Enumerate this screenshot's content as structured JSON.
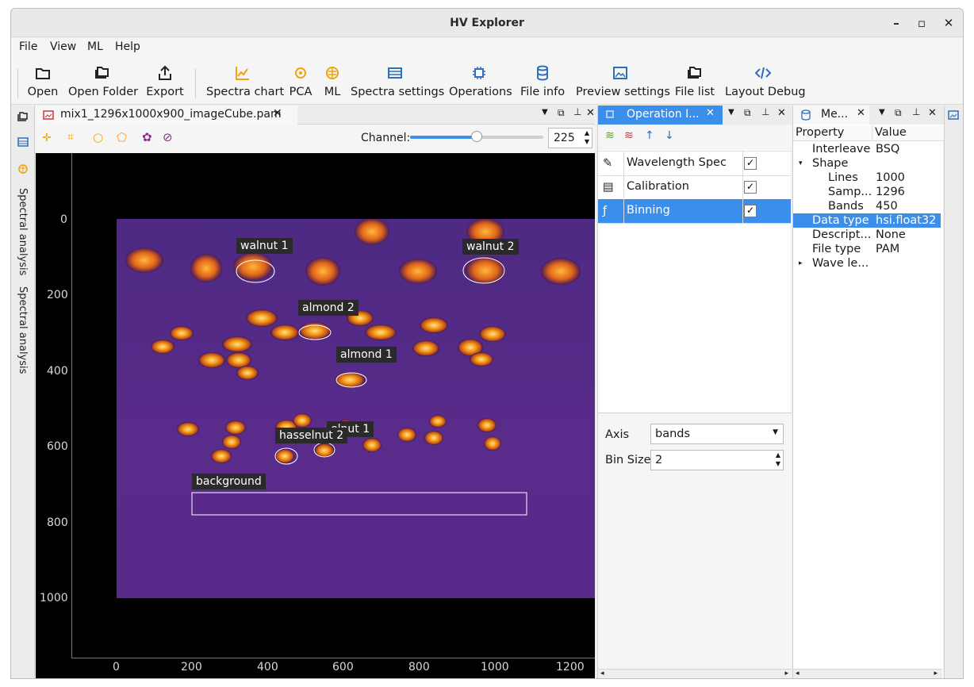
{
  "window": {
    "title": "HV Explorer"
  },
  "menu": [
    "File",
    "View",
    "ML",
    "Help"
  ],
  "toolbar": {
    "open": "Open",
    "open_folder": "Open Folder",
    "export": "Export",
    "spectra_chart": "Spectra chart",
    "pca": "PCA",
    "ml": "ML",
    "spectra_settings": "Spectra settings",
    "operations": "Operations",
    "file_info": "File info",
    "preview_settings": "Preview settings",
    "file_list": "File list",
    "layout_debug": "Layout Debug"
  },
  "left_strip": {
    "tab1": "Spectral analysis",
    "tab2": "Spectral analysis"
  },
  "viewer": {
    "tab_title": "mix1_1296x1000x900_imageCube.pam",
    "channel_label": "Channel:",
    "channel_value": "225",
    "channel_fraction": 0.5,
    "roi_labels": {
      "walnut1": "walnut 1",
      "walnut2": "walnut 2",
      "almond2": "almond 2",
      "almond1": "almond 1",
      "hasselnut1": "elnut 1",
      "hasselnut2": "hasselnut 2",
      "background": "background"
    },
    "y_ticks": [
      "0",
      "200",
      "400",
      "600",
      "800",
      "1000"
    ],
    "x_ticks": [
      "0",
      "200",
      "400",
      "600",
      "800",
      "1000",
      "1200"
    ]
  },
  "operations": {
    "tab_title": "Operation I...",
    "rows": [
      {
        "label": "Wavelength Spec",
        "checked": "✓"
      },
      {
        "label": "Calibration",
        "checked": "✓"
      },
      {
        "label": "Binning",
        "checked": "✓"
      }
    ],
    "axis_label": "Axis",
    "axis_value": "bands",
    "bin_label": "Bin Size",
    "bin_value": "2"
  },
  "metadata": {
    "tab_title": "Me...",
    "col_property": "Property",
    "col_value": "Value",
    "rows": [
      {
        "p": "Interleave",
        "v": "BSQ"
      },
      {
        "p": "Shape",
        "v": ""
      },
      {
        "p": "Lines",
        "v": "1000"
      },
      {
        "p": "Samp...",
        "v": "1296"
      },
      {
        "p": "Bands",
        "v": "450"
      },
      {
        "p": "Data type",
        "v": "hsi.float32"
      },
      {
        "p": "Descript...",
        "v": "None"
      },
      {
        "p": "File type",
        "v": "PAM"
      },
      {
        "p": "Wave le...",
        "v": ""
      }
    ]
  },
  "colors": {
    "accent": "#3b8eea",
    "icon_orange": "#f0a30a",
    "icon_blue": "#2e6fb7",
    "image_bg": "#5a2a8a"
  }
}
